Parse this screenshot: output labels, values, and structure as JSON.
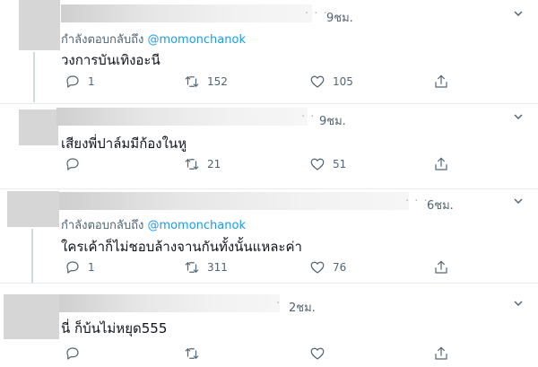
{
  "tweets": [
    {
      "time": "9ชม.",
      "reply_prefix": "กำลังตอบกลับถึง",
      "reply_handle": "@momonchanok",
      "text": "วงการบันเทิงอะนี",
      "replies": "1",
      "retweets": "152",
      "likes": "105"
    },
    {
      "time": "9ชม.",
      "text": "เสียงพี่ปาล์มมีก้องในหู",
      "replies": "",
      "retweets": "21",
      "likes": "51"
    },
    {
      "time": "6ชม.",
      "reply_prefix": "กำลังตอบกลับถึง",
      "reply_handle": "@momonchanok",
      "text": "ใครเค้าก็ไม่ชอบล้างจานกันทั้งนั้นแหละค่า",
      "replies": "1",
      "retweets": "311",
      "likes": "76"
    },
    {
      "time": "2ชม.",
      "text": "นี่ ก็บ้นไม่หยุด555",
      "replies": "",
      "retweets": "",
      "likes": ""
    }
  ]
}
